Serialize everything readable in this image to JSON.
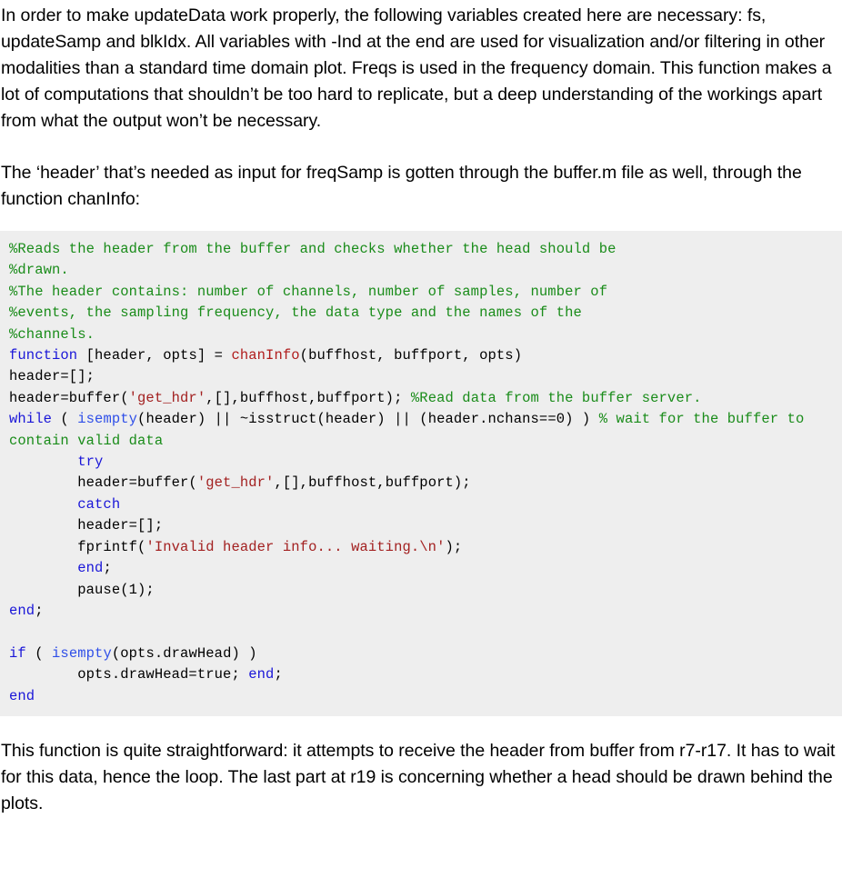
{
  "document": {
    "paragraphs": {
      "intro": "In order to make updateData work properly, the following variables created here are necessary: fs, updateSamp and blkIdx. All variables with -Ind at the end are used for visualization and/or filtering in other modalities than a standard time domain plot. Freqs is used in the frequency domain. This function makes a lot of computations that shouldn’t be too hard to replicate, but a deep understanding of the workings apart from what the output won’t be necessary.",
      "header_intro": "The ‘header’ that’s needed as input for freqSamp is gotten through the buffer.m file as well, through the function chanInfo:",
      "closing": "This function is quite straightforward: it attempts to receive the header from buffer from r7-r17. It has to wait for this data, hence the loop. The last part at r19 is concerning whether a head should be drawn behind the plots."
    },
    "code_block": {
      "language": "matlab",
      "background_color": "#eeeeee",
      "colors": {
        "comment": "#1a8c1a",
        "keyword": "#1a16d8",
        "builtin": "#2f4fe8",
        "string": "#a32121",
        "function_name": "#b01c1c",
        "plain": "#000000"
      },
      "lines": [
        {
          "segments": [
            {
              "t": "%Reads the header from the buffer and checks whether the head should be",
              "c": "cmt"
            }
          ]
        },
        {
          "segments": [
            {
              "t": "%drawn.",
              "c": "cmt"
            }
          ]
        },
        {
          "segments": [
            {
              "t": "%The header contains: number of channels, number of samples, number of",
              "c": "cmt"
            }
          ]
        },
        {
          "segments": [
            {
              "t": "%events, the sampling frequency, the data type and the names of the",
              "c": "cmt"
            }
          ]
        },
        {
          "segments": [
            {
              "t": "%channels.",
              "c": "cmt"
            }
          ]
        },
        {
          "segments": [
            {
              "t": "function",
              "c": "kw"
            },
            {
              "t": " [header, opts] = ",
              "c": ""
            },
            {
              "t": "chanInfo",
              "c": "name"
            },
            {
              "t": "(buffhost, buffport, opts)",
              "c": ""
            }
          ]
        },
        {
          "segments": [
            {
              "t": "header=[];",
              "c": ""
            }
          ]
        },
        {
          "segments": [
            {
              "t": "header=buffer(",
              "c": ""
            },
            {
              "t": "'get_hdr'",
              "c": "str"
            },
            {
              "t": ",[],buffhost,buffport); ",
              "c": ""
            },
            {
              "t": "%Read data from the buffer server.",
              "c": "cmt"
            }
          ]
        },
        {
          "segments": [
            {
              "t": "while",
              "c": "kw"
            },
            {
              "t": " ( ",
              "c": ""
            },
            {
              "t": "isempty",
              "c": "fn"
            },
            {
              "t": "(header) || ~isstruct(header) || (header.nchans==0) ) ",
              "c": ""
            },
            {
              "t": "% wait for the buffer to",
              "c": "cmt"
            }
          ]
        },
        {
          "segments": [
            {
              "t": "contain valid data",
              "c": "cmt"
            }
          ]
        },
        {
          "segments": [
            {
              "t": "        ",
              "c": ""
            },
            {
              "t": "try",
              "c": "kw"
            }
          ]
        },
        {
          "segments": [
            {
              "t": "        header=buffer(",
              "c": ""
            },
            {
              "t": "'get_hdr'",
              "c": "str"
            },
            {
              "t": ",[],buffhost,buffport);",
              "c": ""
            }
          ]
        },
        {
          "segments": [
            {
              "t": "        ",
              "c": ""
            },
            {
              "t": "catch",
              "c": "kw"
            }
          ]
        },
        {
          "segments": [
            {
              "t": "        header=[];",
              "c": ""
            }
          ]
        },
        {
          "segments": [
            {
              "t": "        fprintf(",
              "c": ""
            },
            {
              "t": "'Invalid header info... waiting.\\n'",
              "c": "str"
            },
            {
              "t": ");",
              "c": ""
            }
          ]
        },
        {
          "segments": [
            {
              "t": "        ",
              "c": ""
            },
            {
              "t": "end",
              "c": "kw"
            },
            {
              "t": ";",
              "c": ""
            }
          ]
        },
        {
          "segments": [
            {
              "t": "        pause(1);",
              "c": ""
            }
          ]
        },
        {
          "segments": [
            {
              "t": "end",
              "c": "kw"
            },
            {
              "t": ";",
              "c": ""
            }
          ]
        },
        {
          "segments": []
        },
        {
          "segments": [
            {
              "t": "if",
              "c": "kw"
            },
            {
              "t": " ( ",
              "c": ""
            },
            {
              "t": "isempty",
              "c": "fn"
            },
            {
              "t": "(opts.drawHead) )",
              "c": ""
            }
          ]
        },
        {
          "segments": [
            {
              "t": "        opts.drawHead=true; ",
              "c": ""
            },
            {
              "t": "end",
              "c": "kw"
            },
            {
              "t": ";",
              "c": ""
            }
          ]
        },
        {
          "segments": [
            {
              "t": "end",
              "c": "kw"
            }
          ]
        }
      ]
    }
  }
}
